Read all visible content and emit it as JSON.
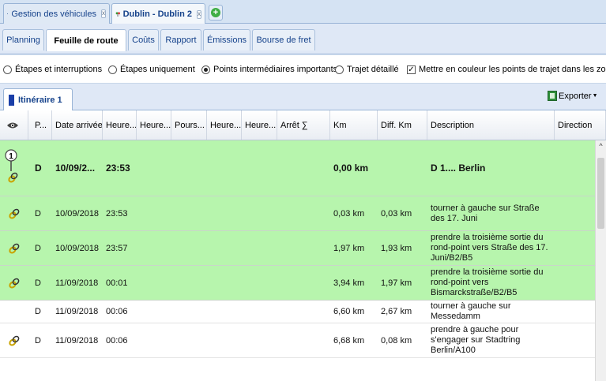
{
  "doc_tabs": [
    {
      "label": "Gestion des véhicules",
      "active": false,
      "icon": "vehicle-icon"
    },
    {
      "label": "Dublin - Dublin 2",
      "active": true,
      "icon": "route-pin-icon"
    }
  ],
  "sub_tabs": [
    {
      "label": "Planning"
    },
    {
      "label": "Feuille de route",
      "active": true
    },
    {
      "label": "Coûts"
    },
    {
      "label": "Rapport"
    },
    {
      "label": "Émissions"
    },
    {
      "label": "Bourse de fret"
    }
  ],
  "options": {
    "radio_etapes_interruptions": "Étapes et interruptions",
    "radio_etapes_uniquement": "Étapes uniquement",
    "radio_points_importants": "Points intermédiaires importants",
    "radio_trajet_detaille": "Trajet détaillé",
    "checkbox_couleur": "Mettre en couleur les points de trajet dans les zones e",
    "selected": "radio_points_importants",
    "checkbox_checked": true
  },
  "itinerary": {
    "tab_label": "Itinéraire 1",
    "export_label": "Exporter"
  },
  "columns": [
    "",
    "P...",
    "Date arrivée",
    "Heure...",
    "Heure...",
    "Pours...",
    "Heure...",
    "Heure...",
    "Arrêt ∑",
    "Km",
    "Diff. Km",
    "Description",
    "Direction"
  ],
  "rows": [
    {
      "pin": "1",
      "p": "D",
      "date": "10/09/2...",
      "heure": "23:53",
      "km": "0,00 km",
      "diff": "",
      "desc": "D 1.... Berlin",
      "color": "green",
      "bold": true
    },
    {
      "pin": "",
      "p": "D",
      "date": "10/09/2018",
      "heure": "23:53",
      "km": "0,03 km",
      "diff": "0,03 km",
      "desc": "tourner à gauche sur Straße des 17. Juni",
      "color": "green",
      "bold": false
    },
    {
      "pin": "",
      "p": "D",
      "date": "10/09/2018",
      "heure": "23:57",
      "km": "1,97 km",
      "diff": "1,93 km",
      "desc": "prendre la troisième sortie du rond-point vers Straße des 17. Juni/B2/B5",
      "color": "green",
      "bold": false
    },
    {
      "pin": "",
      "p": "D",
      "date": "11/09/2018",
      "heure": "00:01",
      "km": "3,94 km",
      "diff": "1,97 km",
      "desc": "prendre la troisième sortie du rond-point vers Bismarckstraße/B2/B5",
      "color": "green",
      "bold": false
    },
    {
      "pin": "",
      "p": "D",
      "date": "11/09/2018",
      "heure": "00:06",
      "km": "6,60 km",
      "diff": "2,67 km",
      "desc": "tourner à gauche sur Messedamm",
      "color": "white",
      "bold": false,
      "no_icon": true
    },
    {
      "pin": "",
      "p": "D",
      "date": "11/09/2018",
      "heure": "00:06",
      "km": "6,68 km",
      "diff": "0,08 km",
      "desc": "prendre à gauche pour s'engager sur Stadtring Berlin/A100",
      "color": "white",
      "bold": false
    }
  ]
}
